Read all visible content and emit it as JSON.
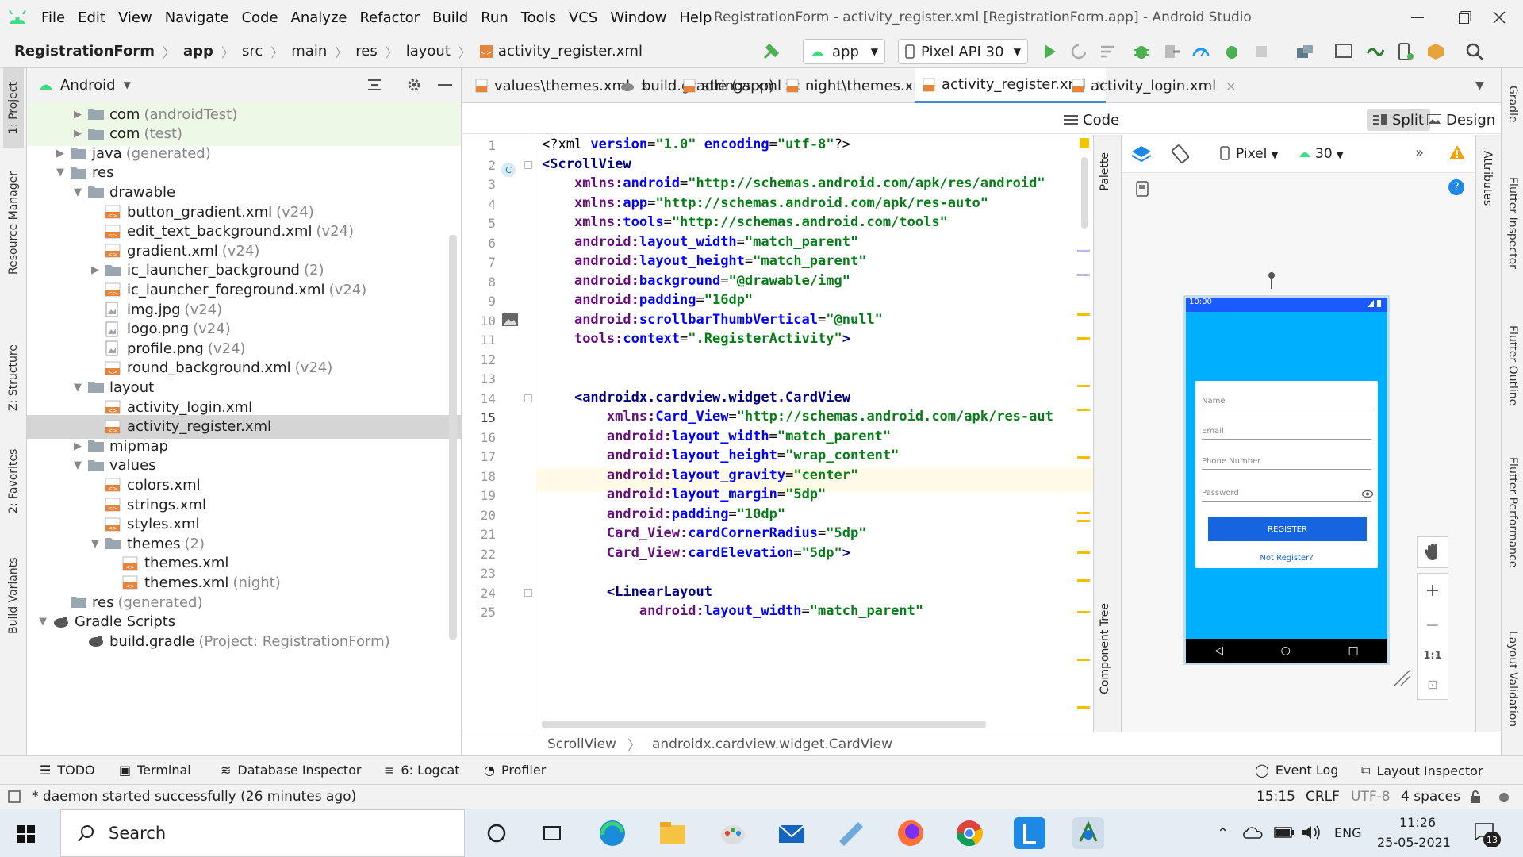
{
  "menu": {
    "items": [
      "File",
      "Edit",
      "View",
      "Navigate",
      "Code",
      "Analyze",
      "Refactor",
      "Build",
      "Run",
      "Tools",
      "VCS",
      "Window",
      "Help"
    ],
    "window_title": "RegistrationForm - activity_register.xml [RegistrationForm.app] - Android Studio"
  },
  "nav": {
    "breadcrumb": [
      "RegistrationForm",
      "app",
      "src",
      "main",
      "res",
      "layout",
      "activity_register.xml"
    ],
    "run_config": "app",
    "device": "Pixel API 30"
  },
  "project": {
    "view": "Android",
    "tree": [
      {
        "label": "com",
        "suffix": "(androidTest)",
        "indent": 2,
        "arrow": "▶",
        "icon": "folder"
      },
      {
        "label": "com",
        "suffix": "(test)",
        "indent": 2,
        "arrow": "▶",
        "icon": "folder"
      },
      {
        "label": "java",
        "suffix": "(generated)",
        "indent": 1,
        "arrow": "▶",
        "icon": "folder"
      },
      {
        "label": "res",
        "suffix": "",
        "indent": 1,
        "arrow": "▼",
        "icon": "folder"
      },
      {
        "label": "drawable",
        "suffix": "",
        "indent": 2,
        "arrow": "▼",
        "icon": "folder"
      },
      {
        "label": "button_gradient.xml",
        "suffix": "(v24)",
        "indent": 3,
        "arrow": "",
        "icon": "xml"
      },
      {
        "label": "edit_text_background.xml",
        "suffix": "(v24)",
        "indent": 3,
        "arrow": "",
        "icon": "xml"
      },
      {
        "label": "gradient.xml",
        "suffix": "(v24)",
        "indent": 3,
        "arrow": "",
        "icon": "xml"
      },
      {
        "label": "ic_launcher_background",
        "suffix": "(2)",
        "indent": 3,
        "arrow": "▶",
        "icon": "folder"
      },
      {
        "label": "ic_launcher_foreground.xml",
        "suffix": "(v24)",
        "indent": 3,
        "arrow": "",
        "icon": "xml"
      },
      {
        "label": "img.jpg",
        "suffix": "(v24)",
        "indent": 3,
        "arrow": "",
        "icon": "img"
      },
      {
        "label": "logo.png",
        "suffix": "(v24)",
        "indent": 3,
        "arrow": "",
        "icon": "img"
      },
      {
        "label": "profile.png",
        "suffix": "(v24)",
        "indent": 3,
        "arrow": "",
        "icon": "img"
      },
      {
        "label": "round_background.xml",
        "suffix": "(v24)",
        "indent": 3,
        "arrow": "",
        "icon": "xml"
      },
      {
        "label": "layout",
        "suffix": "",
        "indent": 2,
        "arrow": "▼",
        "icon": "folder"
      },
      {
        "label": "activity_login.xml",
        "suffix": "",
        "indent": 3,
        "arrow": "",
        "icon": "xml"
      },
      {
        "label": "activity_register.xml",
        "suffix": "",
        "indent": 3,
        "arrow": "",
        "icon": "xml",
        "selected": true
      },
      {
        "label": "mipmap",
        "suffix": "",
        "indent": 2,
        "arrow": "▶",
        "icon": "folder"
      },
      {
        "label": "values",
        "suffix": "",
        "indent": 2,
        "arrow": "▼",
        "icon": "folder"
      },
      {
        "label": "colors.xml",
        "suffix": "",
        "indent": 3,
        "arrow": "",
        "icon": "xml"
      },
      {
        "label": "strings.xml",
        "suffix": "",
        "indent": 3,
        "arrow": "",
        "icon": "xml"
      },
      {
        "label": "styles.xml",
        "suffix": "",
        "indent": 3,
        "arrow": "",
        "icon": "xml"
      },
      {
        "label": "themes",
        "suffix": "(2)",
        "indent": 3,
        "arrow": "▼",
        "icon": "folder"
      },
      {
        "label": "themes.xml",
        "suffix": "",
        "indent": 4,
        "arrow": "",
        "icon": "xml"
      },
      {
        "label": "themes.xml",
        "suffix": "(night)",
        "indent": 4,
        "arrow": "",
        "icon": "xml"
      },
      {
        "label": "res",
        "suffix": "(generated)",
        "indent": 1,
        "arrow": "",
        "icon": "folder"
      },
      {
        "label": "Gradle Scripts",
        "suffix": "",
        "indent": 0,
        "arrow": "▼",
        "icon": "gradle"
      },
      {
        "label": "build.gradle",
        "suffix": "(Project: RegistrationForm)",
        "indent": 2,
        "arrow": "",
        "icon": "gradle"
      }
    ]
  },
  "tabs": [
    {
      "label": "values\\themes.xml",
      "active": false
    },
    {
      "label": "build.gradle (:app)",
      "active": false
    },
    {
      "label": "strings.xml",
      "active": false
    },
    {
      "label": "night\\themes.xml",
      "active": false
    },
    {
      "label": "activity_register.xml",
      "active": true
    },
    {
      "label": "activity_login.xml",
      "active": false
    }
  ],
  "modes": {
    "code": "Code",
    "split": "Split",
    "design": "Design"
  },
  "editor": {
    "lines": [
      [
        [
          "pl",
          "<?xml "
        ],
        [
          "at",
          "version"
        ],
        [
          "pl",
          "="
        ],
        [
          "st",
          "\"1.0\""
        ],
        [
          "pl",
          " "
        ],
        [
          "at",
          "encoding"
        ],
        [
          "pl",
          "="
        ],
        [
          "st",
          "\"utf-8\""
        ],
        [
          "pl",
          "?>"
        ]
      ],
      [
        [
          "tg",
          "<ScrollView"
        ]
      ],
      [
        [
          "pl",
          "    "
        ],
        [
          "ns",
          "xmlns:"
        ],
        [
          "at",
          "android"
        ],
        [
          "pl",
          "="
        ],
        [
          "st",
          "\"http://schemas.android.com/apk/res/android\""
        ]
      ],
      [
        [
          "pl",
          "    "
        ],
        [
          "ns",
          "xmlns:"
        ],
        [
          "at",
          "app"
        ],
        [
          "pl",
          "="
        ],
        [
          "st",
          "\"http://schemas.android.com/apk/res-auto\""
        ]
      ],
      [
        [
          "pl",
          "    "
        ],
        [
          "ns",
          "xmlns:"
        ],
        [
          "at",
          "tools"
        ],
        [
          "pl",
          "="
        ],
        [
          "st",
          "\"http://schemas.android.com/tools\""
        ]
      ],
      [
        [
          "pl",
          "    "
        ],
        [
          "ns",
          "android:"
        ],
        [
          "at",
          "layout_width"
        ],
        [
          "pl",
          "="
        ],
        [
          "st",
          "\"match_parent\""
        ]
      ],
      [
        [
          "pl",
          "    "
        ],
        [
          "ns",
          "android:"
        ],
        [
          "at",
          "layout_height"
        ],
        [
          "pl",
          "="
        ],
        [
          "st",
          "\"match_parent\""
        ]
      ],
      [
        [
          "pl",
          "    "
        ],
        [
          "ns",
          "android:"
        ],
        [
          "at",
          "background"
        ],
        [
          "pl",
          "="
        ],
        [
          "st",
          "\"@drawable/img\""
        ]
      ],
      [
        [
          "pl",
          "    "
        ],
        [
          "ns",
          "android:"
        ],
        [
          "at",
          "padding"
        ],
        [
          "pl",
          "="
        ],
        [
          "st",
          "\"16dp\""
        ]
      ],
      [
        [
          "pl",
          "    "
        ],
        [
          "ns",
          "android:"
        ],
        [
          "at",
          "scrollbarThumbVertical"
        ],
        [
          "pl",
          "="
        ],
        [
          "st",
          "\"@null\""
        ]
      ],
      [
        [
          "pl",
          "    "
        ],
        [
          "ns",
          "tools:"
        ],
        [
          "at",
          "context"
        ],
        [
          "pl",
          "="
        ],
        [
          "st",
          "\".RegisterActivity\""
        ],
        [
          "tg",
          ">"
        ]
      ],
      [],
      [],
      [
        [
          "pl",
          "    "
        ],
        [
          "tg",
          "<androidx.cardview.widget.CardView"
        ]
      ],
      [
        [
          "pl",
          "        "
        ],
        [
          "ns",
          "xmlns:"
        ],
        [
          "at",
          "Card_View"
        ],
        [
          "pl",
          "="
        ],
        [
          "st",
          "\"http://schemas.android.com/apk/res-aut"
        ]
      ],
      [
        [
          "pl",
          "        "
        ],
        [
          "ns",
          "android:"
        ],
        [
          "at",
          "layout_width"
        ],
        [
          "pl",
          "="
        ],
        [
          "st",
          "\"match_parent\""
        ]
      ],
      [
        [
          "pl",
          "        "
        ],
        [
          "ns",
          "android:"
        ],
        [
          "at",
          "layout_height"
        ],
        [
          "pl",
          "="
        ],
        [
          "st",
          "\"wrap_content\""
        ]
      ],
      [
        [
          "pl",
          "        "
        ],
        [
          "ns",
          "android:"
        ],
        [
          "at",
          "layout_gravity"
        ],
        [
          "pl",
          "="
        ],
        [
          "st",
          "\"center\""
        ]
      ],
      [
        [
          "pl",
          "        "
        ],
        [
          "ns",
          "android:"
        ],
        [
          "at",
          "layout_margin"
        ],
        [
          "pl",
          "="
        ],
        [
          "st",
          "\"5dp\""
        ]
      ],
      [
        [
          "pl",
          "        "
        ],
        [
          "ns",
          "android:"
        ],
        [
          "at",
          "padding"
        ],
        [
          "pl",
          "="
        ],
        [
          "st",
          "\"10dp\""
        ]
      ],
      [
        [
          "pl",
          "        "
        ],
        [
          "ns",
          "Card_View:"
        ],
        [
          "at",
          "cardCornerRadius"
        ],
        [
          "pl",
          "="
        ],
        [
          "st",
          "\"5dp\""
        ]
      ],
      [
        [
          "pl",
          "        "
        ],
        [
          "ns",
          "Card_View:"
        ],
        [
          "at",
          "cardElevation"
        ],
        [
          "pl",
          "="
        ],
        [
          "st",
          "\"5dp\""
        ],
        [
          "tg",
          ">"
        ]
      ],
      [],
      [
        [
          "pl",
          "        "
        ],
        [
          "tg",
          "<LinearLayout"
        ]
      ],
      [
        [
          "pl",
          "            "
        ],
        [
          "ns",
          "android:"
        ],
        [
          "at",
          "layout_width"
        ],
        [
          "pl",
          "="
        ],
        [
          "st",
          "\"match_parent\""
        ]
      ]
    ],
    "current_line": 15
  },
  "design": {
    "device": "Pixel",
    "api": "30",
    "phone": {
      "time": "10:00",
      "fields": [
        "Name",
        "Email",
        "Phone Number",
        "Password"
      ],
      "button": "REGISTER",
      "link": "Not Register?"
    }
  },
  "palette_strip": {
    "palette": "Palette",
    "component_tree": "Component Tree"
  },
  "left_strip": [
    "1: Project",
    "Resource Manager",
    "Z: Structure",
    "2: Favorites",
    "Build Variants"
  ],
  "right_strip": [
    "Gradle",
    "Flutter Inspector",
    "Flutter Outline",
    "Flutter Performance",
    "Layout Validation"
  ],
  "attributes_label": "Attributes",
  "bottom_breadcrumb": [
    "ScrollView",
    "androidx.cardview.widget.CardView"
  ],
  "tool_windows": [
    "TODO",
    "Terminal",
    "Database Inspector",
    "6: Logcat",
    "Profiler"
  ],
  "tool_windows_right": [
    "Event Log",
    "Layout Inspector"
  ],
  "status": {
    "message": "* daemon started successfully (26 minutes ago)",
    "position": "15:15",
    "line_sep": "CRLF",
    "encoding": "UTF-8",
    "indent": "4 spaces"
  },
  "taskbar": {
    "search": "Search",
    "lang": "ENG",
    "time": "11:26",
    "date": "25-05-2021",
    "notif": "13"
  }
}
